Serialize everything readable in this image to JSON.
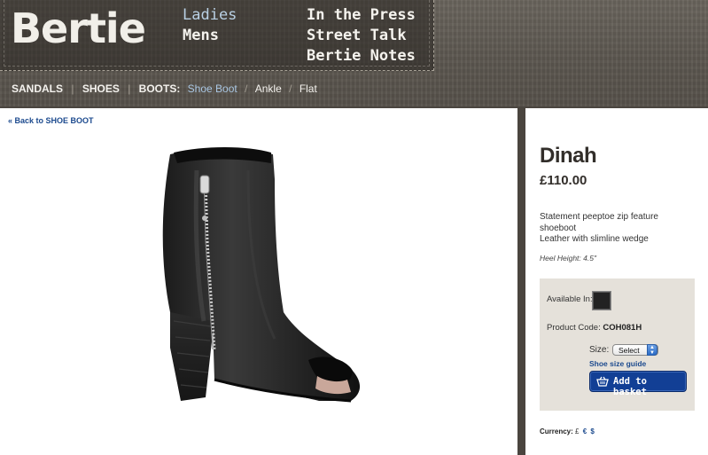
{
  "brand": {
    "logo_text": "Bertie"
  },
  "main_nav": {
    "col1": [
      {
        "label": "Ladies",
        "active": true
      },
      {
        "label": "Mens",
        "active": false
      }
    ],
    "col2": [
      {
        "label": "In the Press"
      },
      {
        "label": "Street Talk"
      },
      {
        "label": "Bertie Notes"
      }
    ]
  },
  "sub_nav": {
    "categories": [
      "SANDALS",
      "SHOES",
      "BOOTS:"
    ],
    "boot_types": [
      {
        "label": "Shoe Boot",
        "active": true
      },
      {
        "label": "Ankle",
        "active": false
      },
      {
        "label": "Flat",
        "active": false
      }
    ]
  },
  "breadcrumb": {
    "back_label": "« Back to SHOE BOOT"
  },
  "product": {
    "name": "Dinah",
    "price": "£110.00",
    "description_lines": [
      "Statement peeptoe zip feature shoeboot",
      "Leather with slimline wedge"
    ],
    "heel_height": "Heel Height: 4.5\"",
    "available_label": "Available In:",
    "swatch_color": "#222222",
    "product_code_label": "Product Code:",
    "product_code": "COH081H",
    "size_label": "Size:",
    "size_selected": "Select",
    "size_guide_label": "Shoe size guide",
    "add_to_basket_label": "Add to basket"
  },
  "currency": {
    "label": "Currency:",
    "options": [
      "£",
      "€",
      "$"
    ]
  },
  "colors": {
    "link_blue": "#1c4a8e",
    "button_blue": "#123f95",
    "panel_beige": "#e5e1da"
  }
}
